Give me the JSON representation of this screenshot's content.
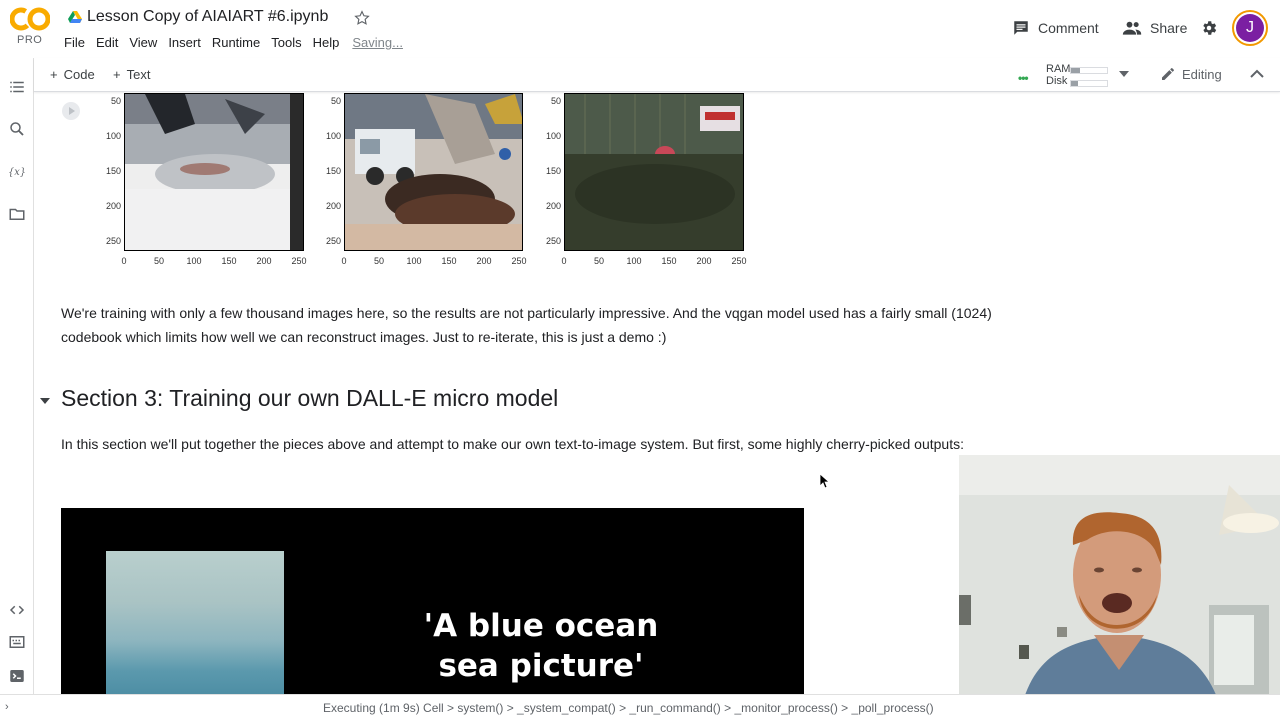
{
  "app": {
    "logo_text": "CO",
    "plan": "PRO",
    "notebook_title": "Lesson Copy of AIAIART #6.ipynb",
    "save_status": "Saving..."
  },
  "menu": [
    "File",
    "Edit",
    "View",
    "Insert",
    "Runtime",
    "Tools",
    "Help"
  ],
  "header_actions": {
    "comment": "Comment",
    "share": "Share",
    "avatar_initial": "J"
  },
  "toolbar": {
    "add_code": "Code",
    "add_text": "Text",
    "ram_label": "RAM",
    "disk_label": "Disk",
    "ram_usage": 0.25,
    "disk_usage": 0.2,
    "mode": "Editing"
  },
  "output_plots": {
    "y_ticks": [
      "50",
      "100",
      "150",
      "200",
      "250"
    ],
    "x_ticks": [
      "0",
      "50",
      "100",
      "150",
      "200",
      "250"
    ]
  },
  "cells": {
    "paragraph1": "We're training with only a few thousand images here, so the results are not particularly impressive. And the vqgan model used has a fairly small (1024) codebook which limits how well we can reconstruct images. Just to re-iterate, this is just a demo :)",
    "section_title": "Section 3: Training our own DALL-E micro model",
    "paragraph2": "In this section we'll put together the pieces above and attempt to make our own text-to-image system. But first, some highly cherry-picked outputs:",
    "video_caption_line1": "'A blue ocean",
    "video_caption_line2": "sea picture'"
  },
  "status_bar": {
    "text": "Executing (1m 9s)  Cell  >  system()  >  _system_compat()  >  _run_command()  >  _monitor_process()  >  _poll_process()"
  },
  "colors": {
    "accent_orange": "#f9ab00",
    "avatar_purple": "#7b1fa2",
    "resource_green": "#34a853"
  }
}
